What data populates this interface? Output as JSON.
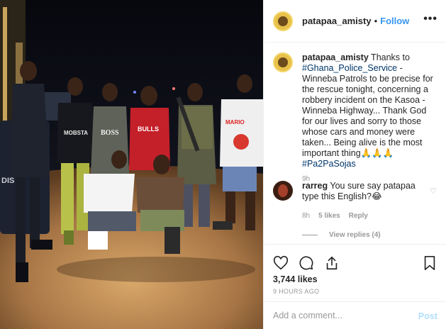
{
  "post": {
    "username": "patapaa_amisty",
    "follow_label": "Follow",
    "more_label": "•••",
    "photo_alt": "Group photo at night"
  },
  "caption": {
    "username": "patapaa_amisty",
    "text_before": " Thanks to ",
    "tag1": "#Ghana_Police_Service",
    "text_after": " - Winneba Patrols to be precise for the rescue tonight, concerning a robbery incident on the Kasoa - Winneba Highway... Thank God for our lives and sorry to those whose cars and money were taken... Being alive is the most important thing🙏🙏🙏 ",
    "tag2": "#Pa2PaSojas",
    "time": "9h"
  },
  "comment": {
    "username": "rarreg",
    "text": " You sure say patapaa type this English?😂",
    "time": "8h",
    "likes": "5 likes",
    "reply_label": "Reply",
    "view_replies": "View replies (4)"
  },
  "actions": {
    "likes": "3,744 likes",
    "ago": "9 HOURS AGO",
    "icons": [
      "heart-icon",
      "comment-icon",
      "share-icon",
      "bookmark-icon"
    ]
  },
  "add_comment": {
    "placeholder": "Add a comment...",
    "post_label": "Post"
  },
  "photo_text": {
    "shirt1": "MOBSTA",
    "shirt2": "BOSS",
    "shirt3": "BULLS",
    "shirt4": "MARIO",
    "vehicle": "DIS"
  },
  "colors": {
    "link": "#3897f0",
    "hashtag": "#003569",
    "muted": "#999999",
    "post_disabled": "#b2dffc"
  }
}
